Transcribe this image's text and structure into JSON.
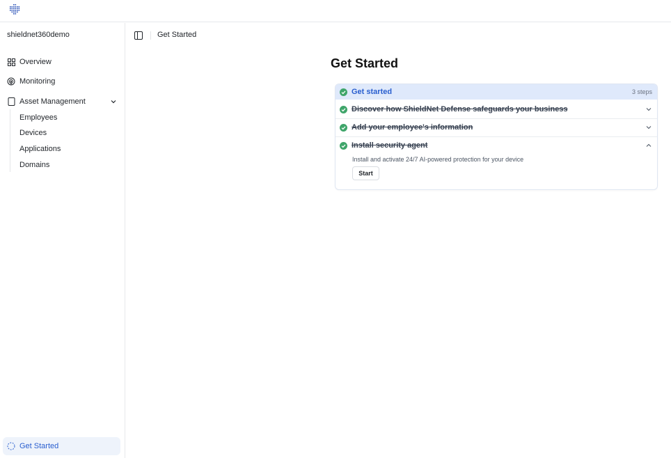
{
  "sidebar": {
    "workspace": "shieldnet360demo",
    "nav": [
      {
        "label": "Overview",
        "icon": "grid-icon"
      },
      {
        "label": "Monitoring",
        "icon": "radar-icon"
      },
      {
        "label": "Asset Management",
        "icon": "device-icon"
      }
    ],
    "asset_sub": [
      "Employees",
      "Devices",
      "Applications",
      "Domains"
    ],
    "bottom": {
      "label": "Get Started",
      "icon": "dashed-circle-icon"
    }
  },
  "breadcrumb": {
    "label": "Get Started"
  },
  "page": {
    "title": "Get Started"
  },
  "checklist": {
    "header": {
      "title": "Get started",
      "count": "3 steps"
    },
    "steps": [
      {
        "label": "Discover how ShieldNet Defense safeguards your business",
        "expanded": false,
        "done": true
      },
      {
        "label": "Add your employee's information",
        "expanded": false,
        "done": true
      },
      {
        "label": "Install security agent",
        "expanded": true,
        "done": true,
        "description": "Install and activate 24/7 AI-powered protection for your device",
        "action": "Start"
      }
    ]
  },
  "colors": {
    "accent": "#2a5fcf",
    "check": "#3fa56a",
    "header_bg": "#dfe9fb"
  }
}
